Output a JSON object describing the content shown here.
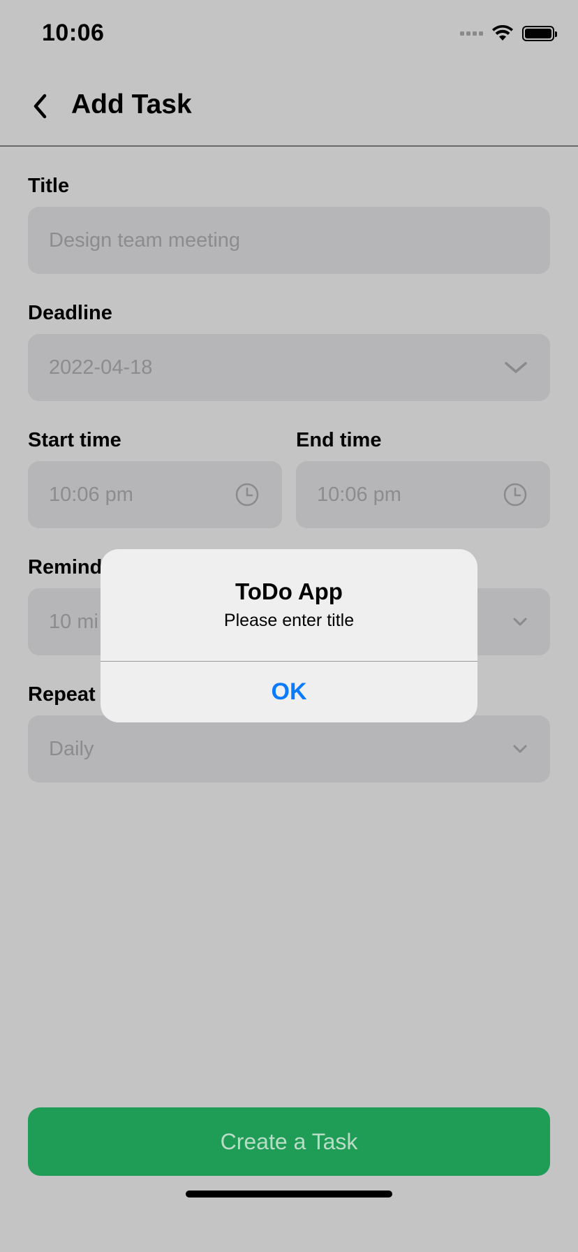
{
  "status_bar": {
    "time": "10:06"
  },
  "header": {
    "title": "Add Task",
    "back_icon": "chevron-left-icon"
  },
  "form": {
    "title": {
      "label": "Title",
      "placeholder": "Design team meeting"
    },
    "deadline": {
      "label": "Deadline",
      "value": "2022-04-18",
      "icon": "chevron-down-icon"
    },
    "start_time": {
      "label": "Start time",
      "value": "10:06 pm",
      "icon": "clock-icon"
    },
    "end_time": {
      "label": "End time",
      "value": "10:06 pm",
      "icon": "clock-icon"
    },
    "remind": {
      "label": "Remind",
      "value": "10 mi",
      "icon": "chevron-down-icon"
    },
    "repeat": {
      "label": "Repeat",
      "value": "Daily",
      "icon": "chevron-down-icon"
    }
  },
  "create_button": {
    "label": "Create a Task"
  },
  "alert": {
    "title": "ToDo App",
    "message": "Please enter title",
    "ok_label": "OK"
  },
  "colors": {
    "accent_green": "#1f9d57",
    "alert_button_blue": "#0a7aff",
    "overlay_background": "#c4c4c4"
  }
}
